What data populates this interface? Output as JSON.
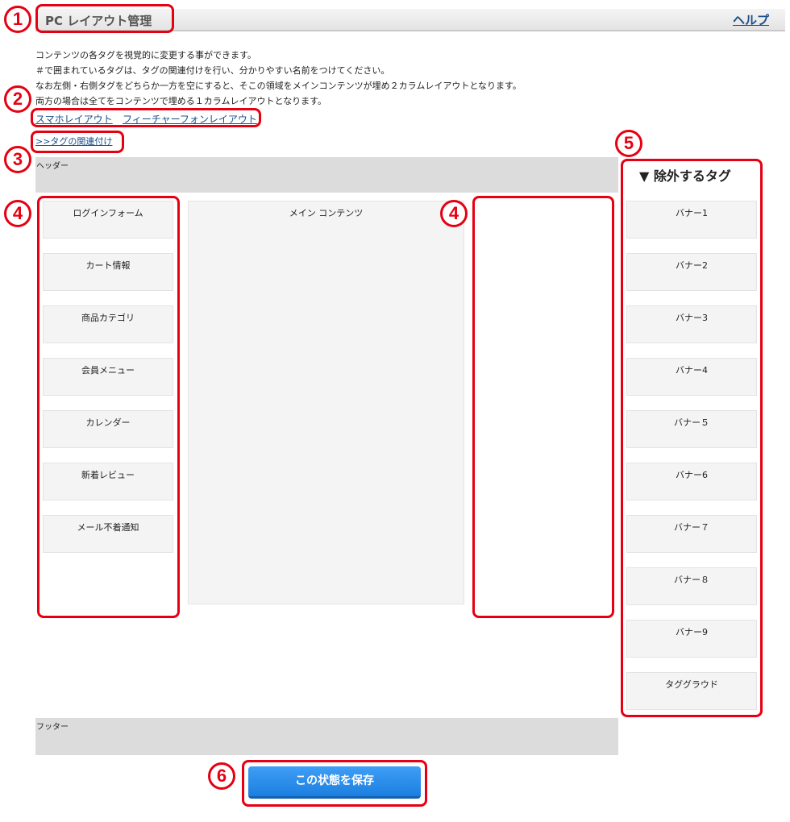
{
  "header": {
    "title": "PC レイアウト管理",
    "help_label": "ヘルプ"
  },
  "description": [
    "コンテンツの各タグを視覚的に変更する事ができます。",
    "＃で囲まれているタグは、タグの関連付けを行い、分かりやすい名前をつけてください。",
    "なお左側・右側タグをどちらか一方を空にすると、そこの領域をメインコンテンツが埋め２カラムレイアウトとなります。",
    "両方の場合は全てをコンテンツで埋める１カラムレイアウトとなります。"
  ],
  "layout_links": {
    "smartphone": "スマホレイアウト",
    "feature_phone": "フィーチャーフォンレイアウト"
  },
  "tag_link": ">>タグの関連付け",
  "zones": {
    "header": "ヘッダー",
    "main": "メイン コンテンツ",
    "footer": "フッター"
  },
  "left_tags": [
    "ログインフォーム",
    "カート情報",
    "商品カテゴリ",
    "会員メニュー",
    "カレンダー",
    "新着レビュー",
    "メール不着通知"
  ],
  "excluded": {
    "title": "▼ 除外するタグ",
    "tags": [
      "バナー1",
      "バナー2",
      "バナー3",
      "バナー4",
      "バナー５",
      "バナー6",
      "バナー７",
      "バナー８",
      "バナー9",
      "タググラウド"
    ]
  },
  "save_label": "この状態を保存",
  "callouts": [
    "1",
    "2",
    "3",
    "4",
    "4",
    "5",
    "6"
  ],
  "colors": {
    "callout": "#e60012",
    "link": "#1a4f8a",
    "button": "#1c7fe0",
    "zone": "#dcdcdc"
  }
}
